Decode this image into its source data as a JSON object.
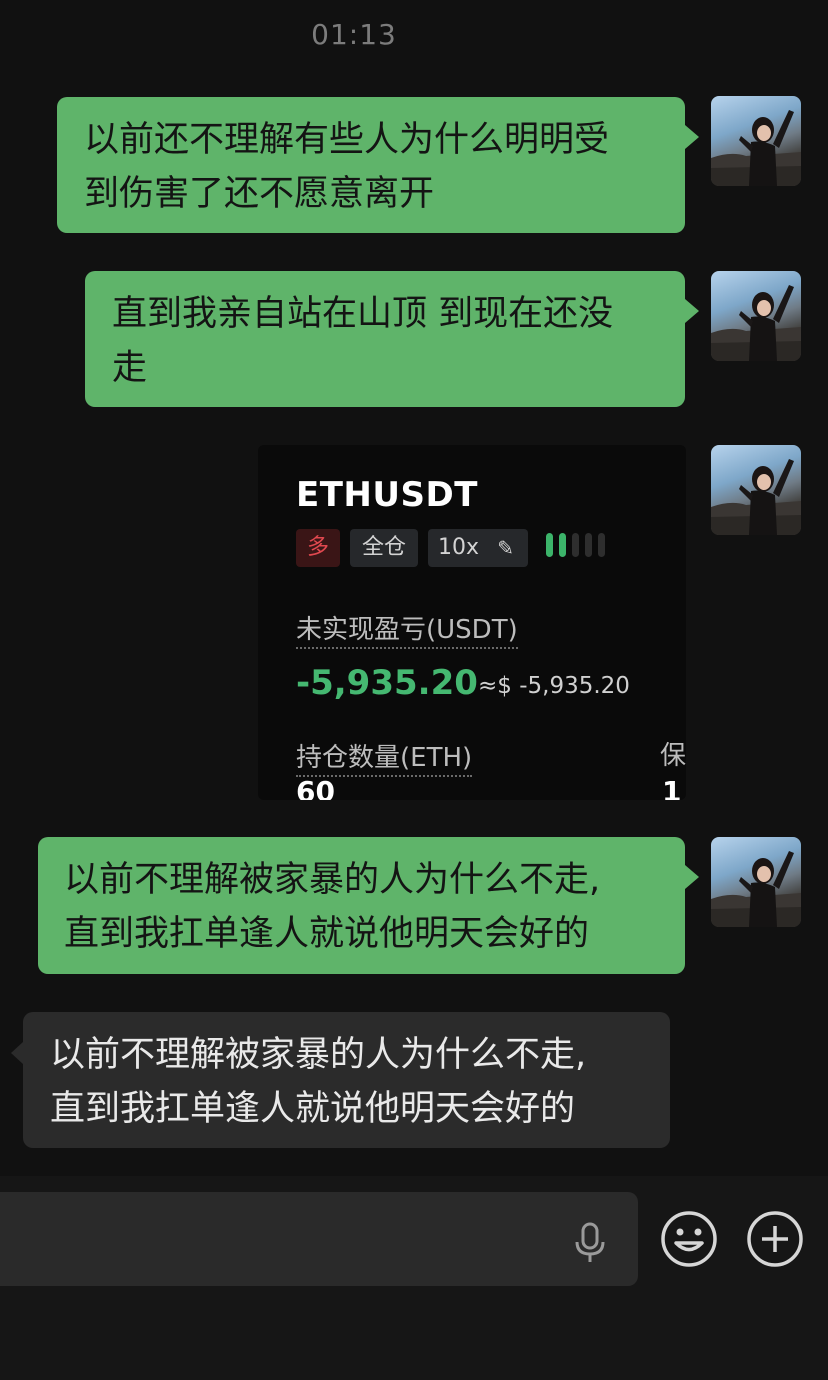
{
  "status": {
    "time": "01:13"
  },
  "messages": [
    {
      "direction": "out",
      "text": "以前还不理解有些人为什么明明受\n到伤害了还不愿意离开"
    },
    {
      "direction": "out",
      "text": "直到我亲自站在山顶 到现在还没\n走"
    },
    {
      "direction": "out",
      "type": "image-card"
    },
    {
      "direction": "out",
      "text": "以前不理解被家暴的人为什么不走,\n直到我扛单逢人就说他明天会好的"
    },
    {
      "direction": "in",
      "text": "以前不理解被家暴的人为什么不走,\n直到我扛单逢人就说他明天会好的"
    }
  ],
  "position_card": {
    "symbol": "ETHUSDT",
    "side_tag": "多",
    "margin_mode_tag": "全仓",
    "leverage_tag": "10x",
    "risk_level": 0.4,
    "pnl_label": "未实现盈亏(USDT)",
    "pnl_value": "-5,935.20",
    "pnl_approx": "≈$ -5,935.20",
    "qty_label": "持仓数量(ETH)",
    "qty_value": "60",
    "margin_label_cut": "保",
    "margin_value_cut": "1"
  },
  "colors": {
    "outgoing_bubble": "#5fb46a",
    "incoming_bubble": "#2b2b2b",
    "pnl_text": "#45b871",
    "long_tag_text": "#e0484f"
  },
  "composer": {
    "voice_icon": "microphone-icon",
    "emoji_icon": "emoji-smile-icon",
    "more_icon": "plus-circle-icon"
  }
}
